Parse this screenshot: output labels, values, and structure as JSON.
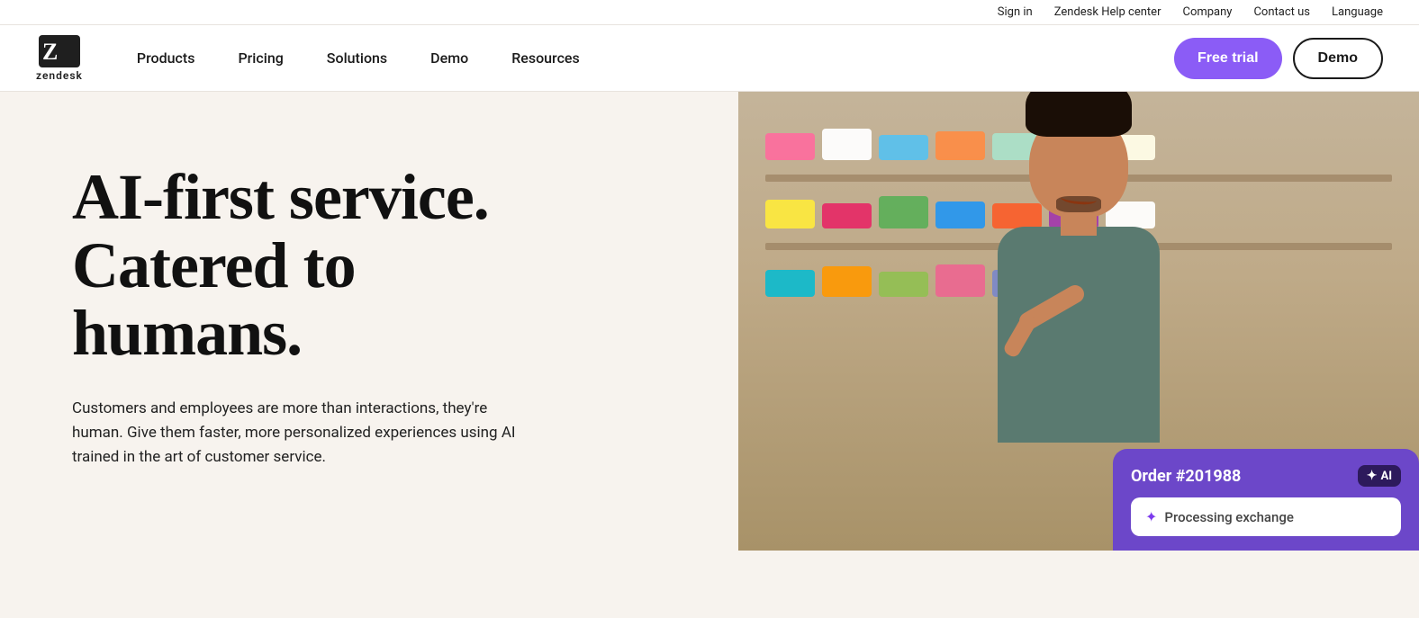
{
  "utility_bar": {
    "sign_in": "Sign in",
    "help_center": "Zendesk Help center",
    "company": "Company",
    "contact_us": "Contact us",
    "language": "Language"
  },
  "navbar": {
    "logo_text": "zendesk",
    "nav_items": [
      {
        "label": "Products"
      },
      {
        "label": "Pricing"
      },
      {
        "label": "Solutions"
      },
      {
        "label": "Demo"
      },
      {
        "label": "Resources"
      }
    ],
    "free_trial_label": "Free trial",
    "demo_label": "Demo",
    "colors": {
      "free_trial_bg": "#8b5cf6",
      "demo_border": "#1a1a1a"
    }
  },
  "hero": {
    "heading_line1": "AI-first service.",
    "heading_line2": "Catered to",
    "heading_line3": "humans.",
    "subtext": "Customers and employees are more than interactions, they're human. Give them faster, more personalized experiences using AI trained in the art of customer service.",
    "order_card": {
      "order_number": "Order #201988",
      "ai_label": "AI ✦",
      "processing_text": "Processing exchange",
      "sparkle": "✦"
    }
  }
}
